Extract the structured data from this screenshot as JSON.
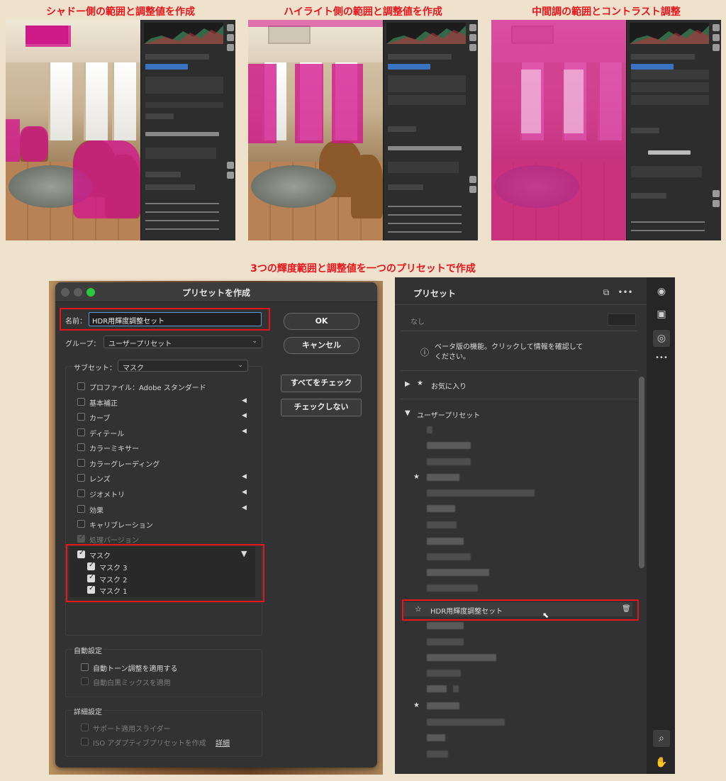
{
  "captions": {
    "shadow": "シャドー側の範囲と調整値を作成",
    "highlight": "ハイライト側の範囲と調整値を作成",
    "midtone": "中間調の範囲とコントラスト調整",
    "main": "3つの輝度範囲と調整値を一つのプリセットで作成"
  },
  "dialog": {
    "title": "プリセットを作成",
    "name_label": "名前：",
    "name_value": "HDR用輝度調整セット",
    "group_label": "グループ：",
    "group_value": "ユーザープリセット",
    "subset_label": "サブセット：",
    "subset_value": "マスク",
    "ok": "OK",
    "cancel": "キャンセル",
    "check_all": "すべてをチェック",
    "check_none": "チェックしない",
    "items": [
      {
        "label": "プロファイル：Adobe スタンダード",
        "checked": false,
        "expand": false
      },
      {
        "label": "基本補正",
        "checked": false,
        "expand": true
      },
      {
        "label": "カーブ",
        "checked": false,
        "expand": true
      },
      {
        "label": "ディテール",
        "checked": false,
        "expand": true
      },
      {
        "label": "カラーミキサー",
        "checked": false,
        "expand": false
      },
      {
        "label": "カラーグレーディング",
        "checked": false,
        "expand": false
      },
      {
        "label": "レンズ",
        "checked": false,
        "expand": true
      },
      {
        "label": "ジオメトリ",
        "checked": false,
        "expand": true
      },
      {
        "label": "効果",
        "checked": false,
        "expand": true
      },
      {
        "label": "キャリブレーション",
        "checked": false,
        "expand": false
      },
      {
        "label": "処理バージョン",
        "checked": true,
        "expand": false,
        "disabled": true
      }
    ],
    "mask_group": {
      "label": "マスク",
      "children": [
        "マスク 3",
        "マスク 2",
        "マスク 1"
      ]
    },
    "auto_settings": {
      "title": "自動設定",
      "items": [
        "自動トーン調整を適用する",
        "自動白黒ミックスを適用"
      ]
    },
    "advanced": {
      "title": "詳細設定",
      "items": [
        "サポート適用スライダー",
        "ISO アダプティブプリセットを作成"
      ],
      "link": "詳細"
    }
  },
  "presets_panel": {
    "title": "プリセット",
    "none": "なし",
    "beta_notice": "ベータ版の機能。クリックして情報を確認してください。",
    "favorites": "お気に入り",
    "user_group": "ユーザープリセット",
    "selected_preset": "HDR用輝度調整セット"
  },
  "colors": {
    "highlight_red": "#e8161c",
    "mask_overlay": "#d2148c",
    "dialog_bg": "#323232"
  }
}
